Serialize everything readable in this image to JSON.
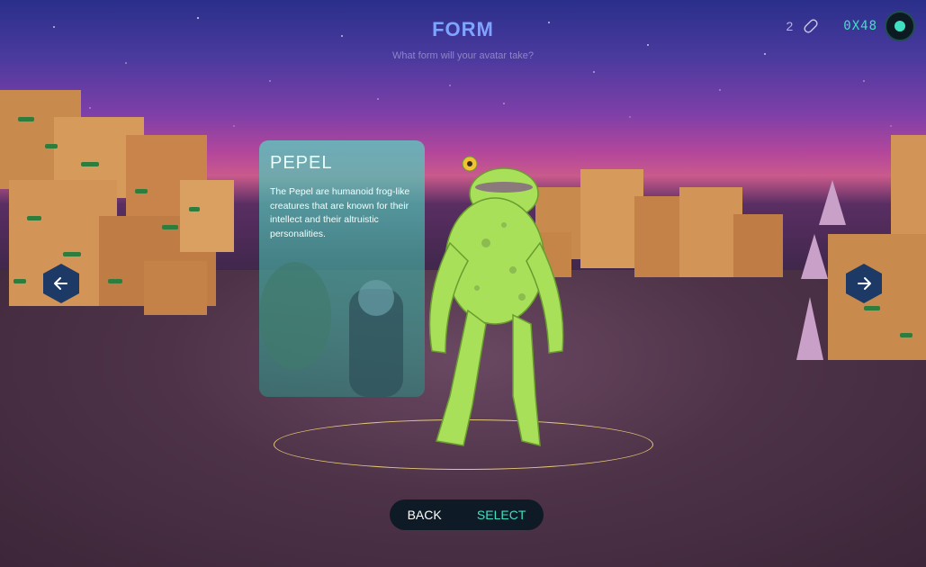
{
  "header": {
    "title": "FORM",
    "subtitle": "What form will your avatar take?"
  },
  "hud": {
    "count": "2",
    "count_icon": "pill-icon",
    "token_label": "0X48",
    "wallet_icon": "wallet-dot-icon"
  },
  "card": {
    "name": "PEPEL",
    "description": "The Pepel are humanoid frog-like creatures that are known for their intellect and their altruistic personalities."
  },
  "navigation": {
    "prev_icon": "arrow-left-icon",
    "next_icon": "arrow-right-icon"
  },
  "actions": {
    "back_label": "BACK",
    "select_label": "SELECT"
  },
  "colors": {
    "accent": "#3fe0c2",
    "title": "#7fa4ff",
    "ring": "#e6c87a",
    "button_bg": "#0e1a26",
    "nav_bg": "#1d3a66"
  }
}
